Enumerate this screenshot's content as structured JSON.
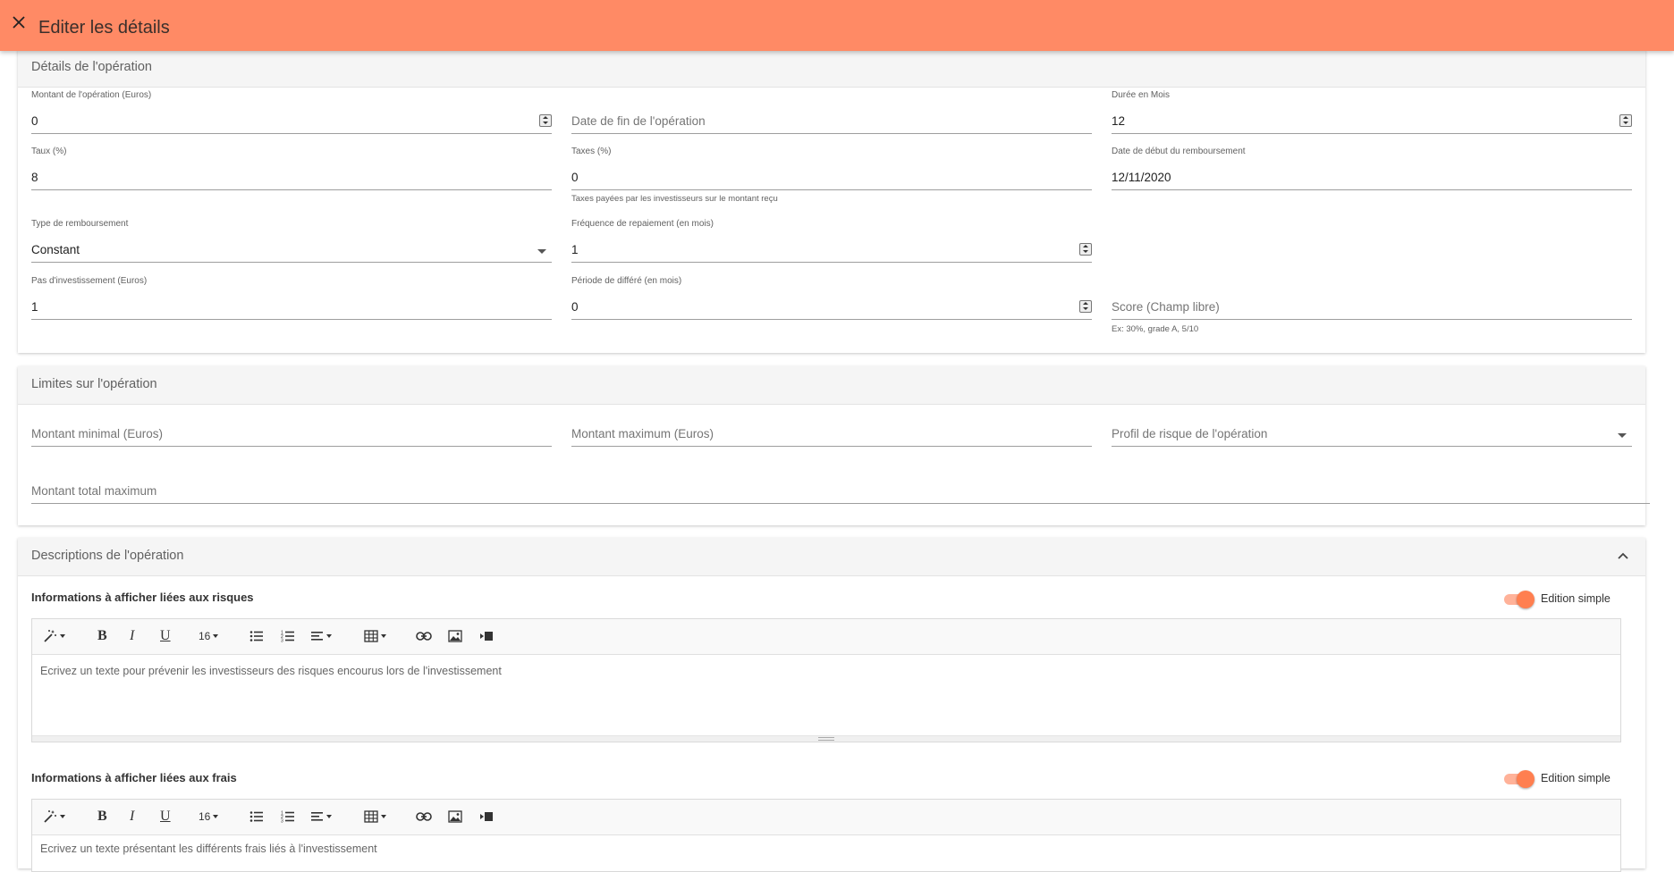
{
  "header": {
    "title": "Editer les détails",
    "close_icon": "close-icon"
  },
  "details": {
    "title": "Détails de l'opération",
    "montant": {
      "label": "Montant de l'opération (Euros)",
      "value": "0"
    },
    "date_fin": {
      "placeholder": "Date de fin de l'opération"
    },
    "duree": {
      "label": "Durée en Mois",
      "value": "12"
    },
    "taux": {
      "label": "Taux (%)",
      "value": "8"
    },
    "taxes": {
      "label": "Taxes (%)",
      "value": "0",
      "hint": "Taxes payées par les investisseurs sur le montant reçu"
    },
    "date_debut": {
      "label": "Date de début du remboursement",
      "value": "12/11/2020"
    },
    "type_remb": {
      "label": "Type de remboursement",
      "value": "Constant"
    },
    "frequence": {
      "label": "Fréquence de repaiement (en mois)",
      "value": "1"
    },
    "pas": {
      "label": "Pas d'investissement (Euros)",
      "value": "1"
    },
    "periode": {
      "label": "Période de différé (en mois)",
      "value": "0"
    },
    "score": {
      "placeholder": "Score (Champ libre)",
      "hint": "Ex: 30%, grade A, 5/10"
    }
  },
  "limites": {
    "title": "Limites sur l'opération",
    "min": {
      "placeholder": "Montant minimal (Euros)"
    },
    "max": {
      "placeholder": "Montant maximum (Euros)"
    },
    "profil": {
      "placeholder": "Profil de risque de l'opération"
    },
    "total": {
      "placeholder": "Montant total maximum"
    }
  },
  "descriptions": {
    "title": "Descriptions de l'opération",
    "risques": {
      "label": "Informations à afficher liées aux risques",
      "toggle_label": "Edition simple",
      "toggle_on": true,
      "placeholder": "Ecrivez un texte pour prévenir les investisseurs des risques encourus lors de l'investissement"
    },
    "frais": {
      "label": "Informations à afficher liées aux frais",
      "toggle_label": "Edition simple",
      "toggle_on": true,
      "placeholder": "Ecrivez un texte présentant les différents frais liés à l'investissement"
    }
  },
  "toolbar": {
    "font_size": "16",
    "bold": "B",
    "italic": "I",
    "underline": "U"
  },
  "colors": {
    "accent": "#ff8a65",
    "toggle": "#ff7f50"
  }
}
